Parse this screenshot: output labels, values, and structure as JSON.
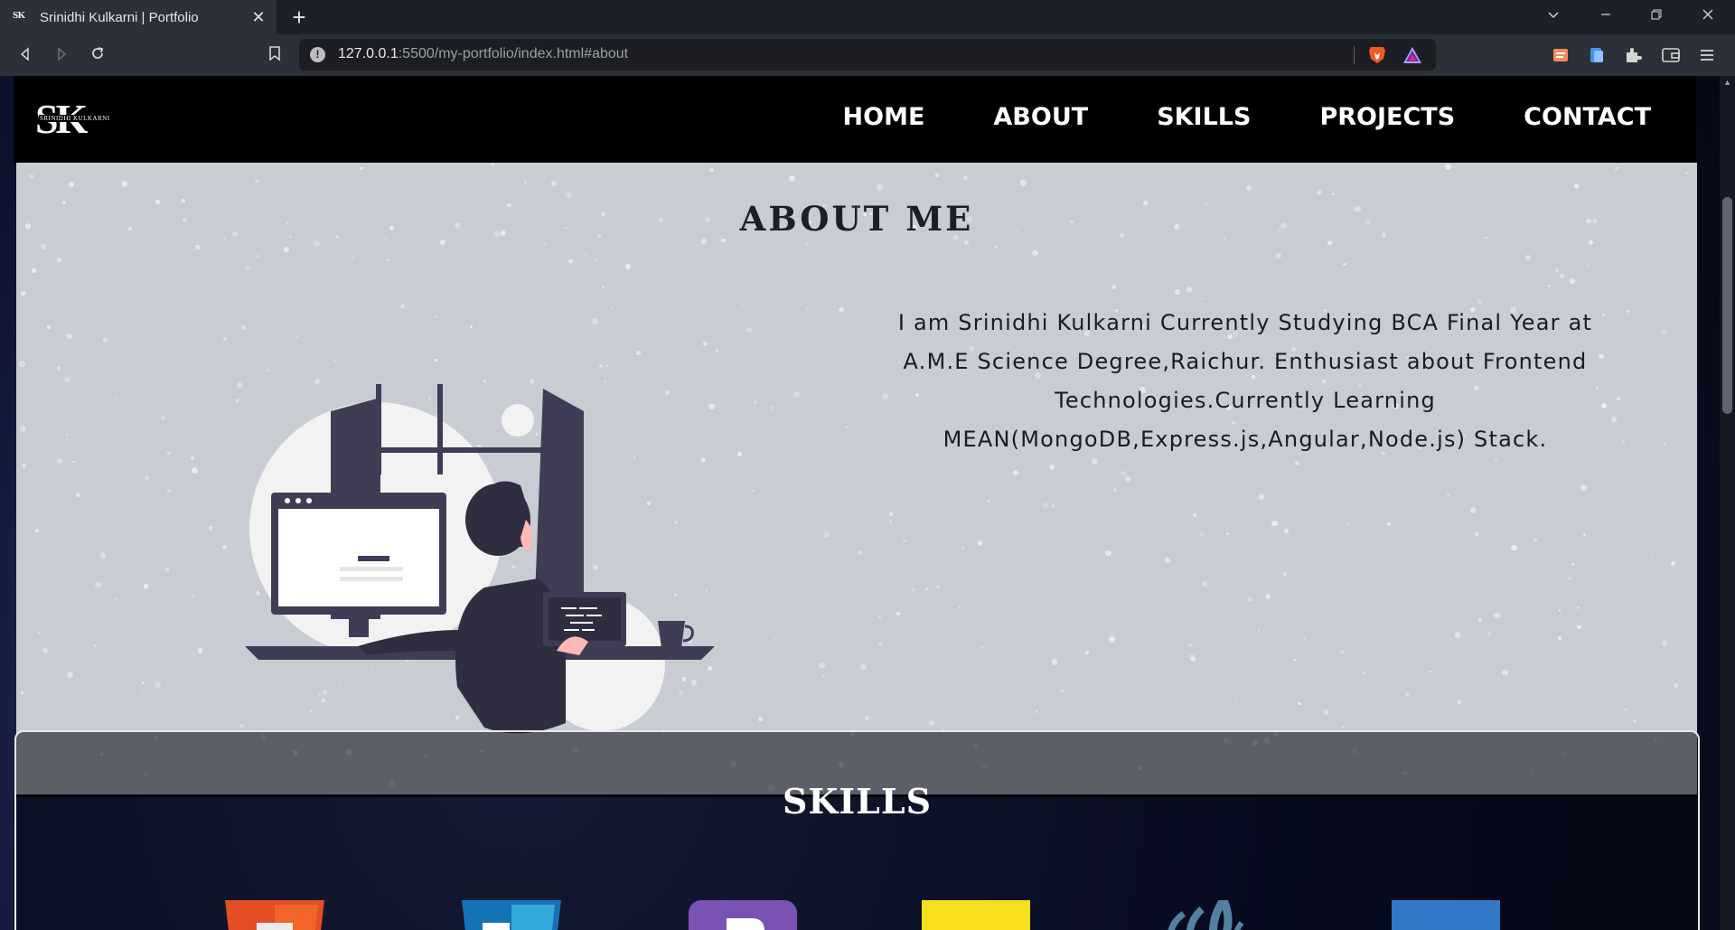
{
  "browser": {
    "tab_favicon": "SK",
    "tab_title": "Srinidhi Kulkarni | Portfolio",
    "url_host": "127.0.0.1",
    "url_rest": ":5500/my-portfolio/index.html#about",
    "icons": [
      "back-icon",
      "forward-icon",
      "reload-icon",
      "bookmark-icon",
      "site-info-icon",
      "brave-shields-icon",
      "brave-rewards-icon",
      "reading-list-icon",
      "wallet-icon",
      "extensions-icon",
      "sidebar-icon",
      "menu-icon"
    ]
  },
  "site": {
    "logo": {
      "big": "SK",
      "small": "SRINIDHI KULKARNI"
    },
    "nav": [
      {
        "label": "HOME"
      },
      {
        "label": "ABOUT"
      },
      {
        "label": "SKILLS"
      },
      {
        "label": "PROJECTS"
      },
      {
        "label": "CONTACT"
      }
    ],
    "about": {
      "title": "ABOUT ME",
      "text": "I am Srinidhi Kulkarni Currently Studying BCA Final Year at A.M.E Science Degree,Raichur. Enthusiast about Frontend Technologies.Currently Learning MEAN(MongoDB,Express.js,Angular,Node.js) Stack."
    },
    "skills": {
      "title": "SKILLS",
      "icons": [
        "html5-icon",
        "css3-icon",
        "bootstrap-icon",
        "javascript-icon",
        "java-icon",
        "typescript-icon"
      ]
    }
  },
  "colors": {
    "nav_bg": "#000000",
    "about_bg": "#c9ccd3",
    "illustration_dark": "#3f3d56",
    "html5": "#e44d26",
    "css3": "#1572b6",
    "bootstrap": "#7952b3",
    "javascript": "#f7df1e",
    "java": "#5382a1",
    "typescript": "#3178c6"
  }
}
